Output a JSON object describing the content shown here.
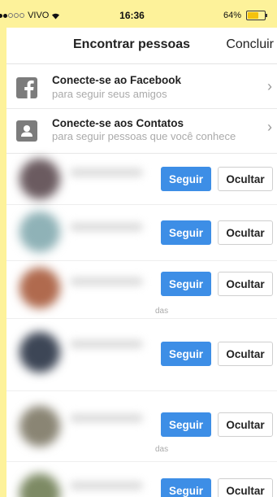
{
  "status_bar": {
    "carrier": "VIVO",
    "time": "16:36",
    "battery": "64%"
  },
  "nav": {
    "title": "Encontrar pessoas",
    "done_label": "Concluir"
  },
  "connect": {
    "facebook": {
      "title": "Conecte-se ao Facebook",
      "subtitle": "para seguir seus amigos",
      "icon": "facebook-icon"
    },
    "contacts": {
      "title": "Conecte-se aos Contatos",
      "subtitle": "para seguir pessoas que você conhece",
      "icon": "contacts-icon"
    }
  },
  "suggestions": {
    "follow_label": "Seguir",
    "hide_label": "Ocultar",
    "items": [
      {
        "sub": ""
      },
      {
        "sub": ""
      },
      {
        "sub": "das"
      },
      {
        "sub": ""
      },
      {
        "sub": "das"
      },
      {
        "sub": ""
      }
    ]
  }
}
